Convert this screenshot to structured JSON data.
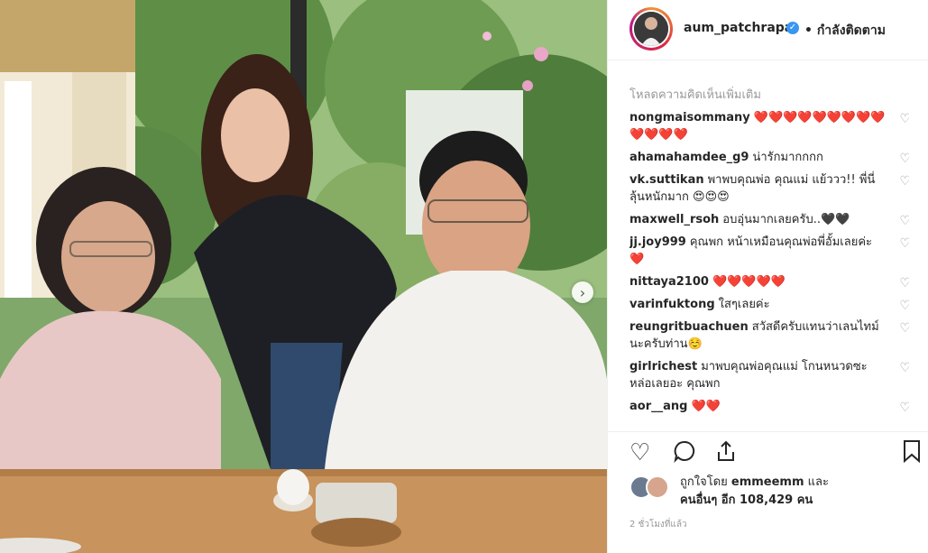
{
  "post": {
    "username": "aum_patchrapa",
    "verified_icon": "verified-badge-icon",
    "follow_status": "• กำลังติดตาม",
    "load_more": "โหลดความคิดเห็นเพิ่มเติม",
    "comments": [
      {
        "user": "nongmaisommany",
        "text": "❤️❤️❤️❤️❤️❤️❤️❤️❤️❤️❤️❤️❤️"
      },
      {
        "user": "ahamahamdee_g9",
        "text": "น่ารักมากกกก"
      },
      {
        "user": "vk.suttikan",
        "text": "พาพบคุณพ่อ คุณแม่ แย้ววว!! พี่นี่ลุ้นหนักมาก 😍😍😍"
      },
      {
        "user": "maxwell_rsoh",
        "text": "อบอุ่นมากเลยครับ..🖤🖤"
      },
      {
        "user": "jj.joy999",
        "text": "คุณพก หน้าเหมือนคุณพ่อพี่อั้มเลยค่ะ ❤️"
      },
      {
        "user": "nittaya2100",
        "text": "❤️❤️❤️❤️❤️"
      },
      {
        "user": "varinfuktong",
        "text": "ใสๆเลยค่ะ"
      },
      {
        "user": "reungritbuachuen",
        "text": "สวัสดีครับแทนว่าเลนไทม์นะครับท่าน☺️"
      },
      {
        "user": "girlrichest",
        "text": "มาพบคุณพ่อคุณแม่ โกนหนวดซะหล่อเลยอะ คุณพก"
      },
      {
        "user": "aor__ang",
        "text": "❤️❤️"
      }
    ],
    "likes_prefix": "ถูกใจโดย",
    "likes_user": "emmeemm",
    "likes_and": "และ",
    "likes_others": "คนอื่นๆ อีก 108,429 คน",
    "timestamp": "2 ชั่วโมงที่แล้ว",
    "icons": {
      "like": "heart-outline-icon",
      "comment": "comment-bubble-icon",
      "share": "share-icon",
      "save": "bookmark-icon",
      "carousel_next": "chevron-right-icon"
    }
  }
}
